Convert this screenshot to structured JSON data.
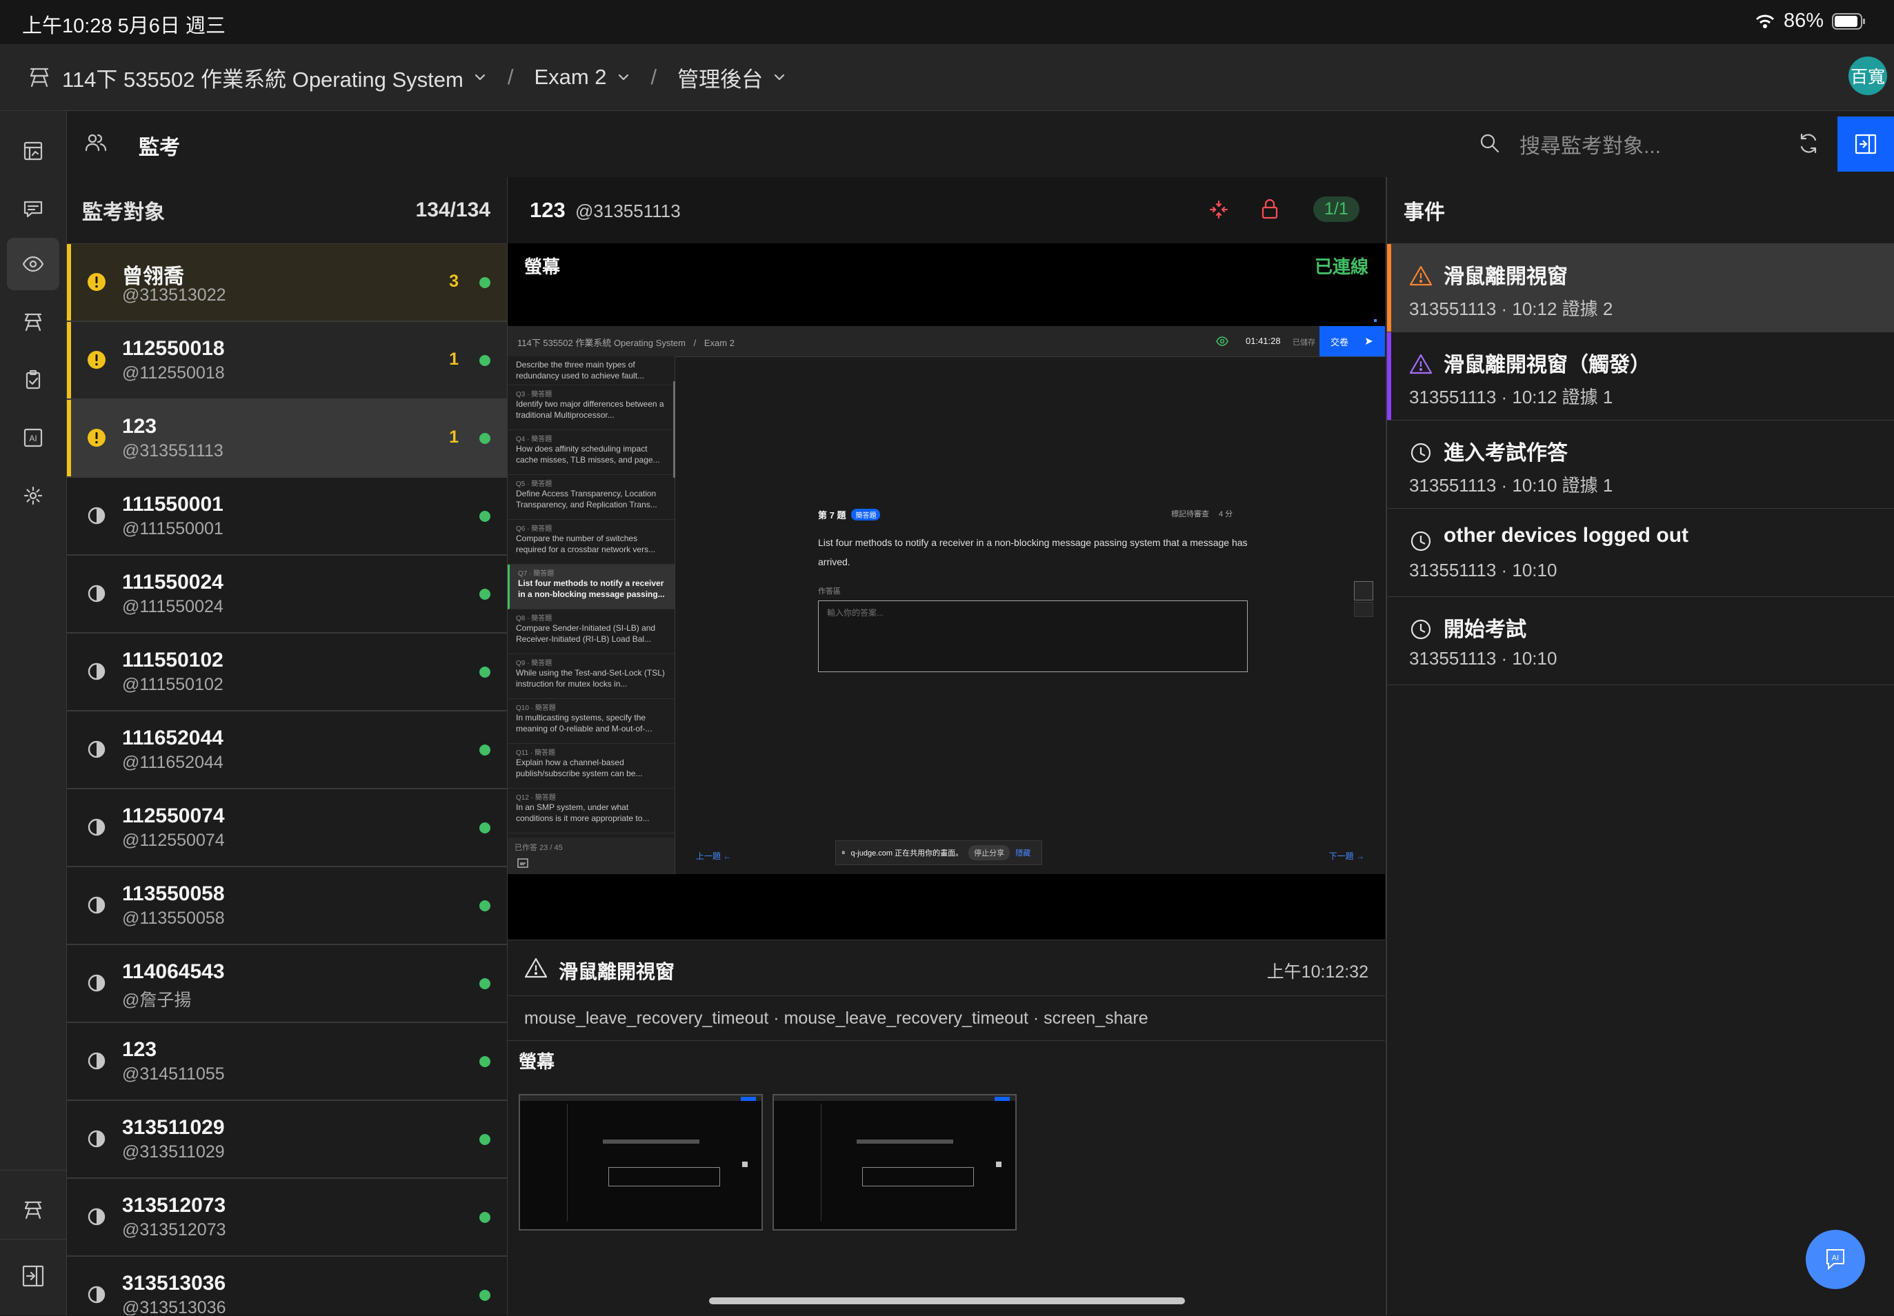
{
  "status_bar": {
    "time": "上午10:28  5月6日 週三",
    "battery": "86%"
  },
  "header": {
    "course": "114下 535502 作業系統 Operating System",
    "exam": "Exam 2",
    "section": "管理後台",
    "avatar": "百寬"
  },
  "sub_header": {
    "title": "監考",
    "search_placeholder": "搜尋監考對象..."
  },
  "list": {
    "title": "監考對象",
    "count": "134/134",
    "items": [
      {
        "name": "曾翎喬",
        "handle": "@313513022",
        "alerts": "3",
        "state": "warning"
      },
      {
        "name": "112550018",
        "handle": "@112550018",
        "alerts": "1",
        "state": "warning"
      },
      {
        "name": "123",
        "handle": "@313551113",
        "alerts": "1",
        "state": "warning-selected"
      },
      {
        "name": "111550001",
        "handle": "@111550001",
        "alerts": "",
        "state": "ok"
      },
      {
        "name": "111550024",
        "handle": "@111550024",
        "alerts": "",
        "state": "ok"
      },
      {
        "name": "111550102",
        "handle": "@111550102",
        "alerts": "",
        "state": "ok"
      },
      {
        "name": "111652044",
        "handle": "@111652044",
        "alerts": "",
        "state": "ok"
      },
      {
        "name": "112550074",
        "handle": "@112550074",
        "alerts": "",
        "state": "ok"
      },
      {
        "name": "113550058",
        "handle": "@113550058",
        "alerts": "",
        "state": "ok"
      },
      {
        "name": "114064543",
        "handle": "@詹子揚",
        "alerts": "",
        "state": "ok"
      },
      {
        "name": "123",
        "handle": "@314511055",
        "alerts": "",
        "state": "ok"
      },
      {
        "name": "313511029",
        "handle": "@313511029",
        "alerts": "",
        "state": "ok"
      },
      {
        "name": "313512073",
        "handle": "@313512073",
        "alerts": "",
        "state": "ok"
      },
      {
        "name": "313513036",
        "handle": "@313513036",
        "alerts": "",
        "state": "ok"
      }
    ]
  },
  "center": {
    "name": "123",
    "handle": "@313551113",
    "page_badge": "1/1",
    "screen_label": "螢幕",
    "connection": "已連線",
    "shot": {
      "course": "114下 535502 作業系統 Operating System",
      "exam": "Exam 2",
      "timer": "01:41:28",
      "saved": "已儲存",
      "submit": "交卷",
      "questions": [
        {
          "no": "",
          "text": "Describe the three main types of redundancy used to achieve fault..."
        },
        {
          "no": "Q3 · 簡答題",
          "text": "Identify two major differences between a traditional Multiprocessor..."
        },
        {
          "no": "Q4 · 簡答題",
          "text": "How does affinity scheduling impact cache misses, TLB misses, and page..."
        },
        {
          "no": "Q5 · 簡答題",
          "text": "Define Access Transparency, Location Transparency, and Replication Trans..."
        },
        {
          "no": "Q6 · 簡答題",
          "text": "Compare the number of switches required for a crossbar network vers..."
        },
        {
          "no": "Q7 · 簡答題",
          "text": "List four methods to notify a receiver in a non-blocking message passing..."
        },
        {
          "no": "Q8 · 簡答題",
          "text": "Compare Sender-Initiated (SI-LB) and Receiver-Initiated (RI-LB) Load Bal..."
        },
        {
          "no": "Q9 · 簡答題",
          "text": "While using the Test-and-Set-Lock (TSL) instruction for mutex locks in..."
        },
        {
          "no": "Q10 · 簡答題",
          "text": "In multicasting systems, specify the meaning of 0-reliable and M-out-of-..."
        },
        {
          "no": "Q11 · 簡答題",
          "text": "Explain how a channel-based publish/subscribe system can be..."
        },
        {
          "no": "Q12 · 簡答題",
          "text": "In an SMP system, under what conditions is it more appropriate to..."
        }
      ],
      "answered": "已作答 23 / 45",
      "q_title": "第 7 題",
      "q_type": "簡答題",
      "flag": "標記待審查",
      "points": "4 分",
      "q_text": "List four methods to notify a receiver in a non-blocking message passing system that a message has arrived.",
      "answer_label": "作答區",
      "answer_placeholder": "輸入你的答案...",
      "prev": "上一題",
      "next": "下一題",
      "share_notice": "q-judge.com 正在共用你的畫面。",
      "stop_share": "停止分享",
      "hide": "隱藏"
    }
  },
  "detail": {
    "title": "滑鼠離開視窗",
    "time": "上午10:12:32",
    "tags": "mouse_leave_recovery_timeout · mouse_leave_recovery_timeout · screen_share",
    "section": "螢幕"
  },
  "events": {
    "title": "事件",
    "items": [
      {
        "title": "滑鼠離開視窗",
        "meta": "313551113 · 10:12   證據 2",
        "kind": "warning",
        "accent": "#ff832b"
      },
      {
        "title": "滑鼠離開視窗（觸發）",
        "meta": "313551113 · 10:12   證據 1",
        "kind": "trigger",
        "accent": "#8a3ffc"
      },
      {
        "title": "進入考試作答",
        "meta": "313551113 · 10:10   證據 1",
        "kind": "clock",
        "accent": ""
      },
      {
        "title": "other devices logged out",
        "meta": "313551113 · 10:10",
        "kind": "clock",
        "accent": ""
      },
      {
        "title": "開始考試",
        "meta": "313551113 · 10:10",
        "kind": "clock",
        "accent": ""
      }
    ]
  },
  "colors": {
    "accent": "#0f62fe",
    "warning": "#f1c21b",
    "online": "#42be65",
    "alert_red": "#fa4d56"
  }
}
